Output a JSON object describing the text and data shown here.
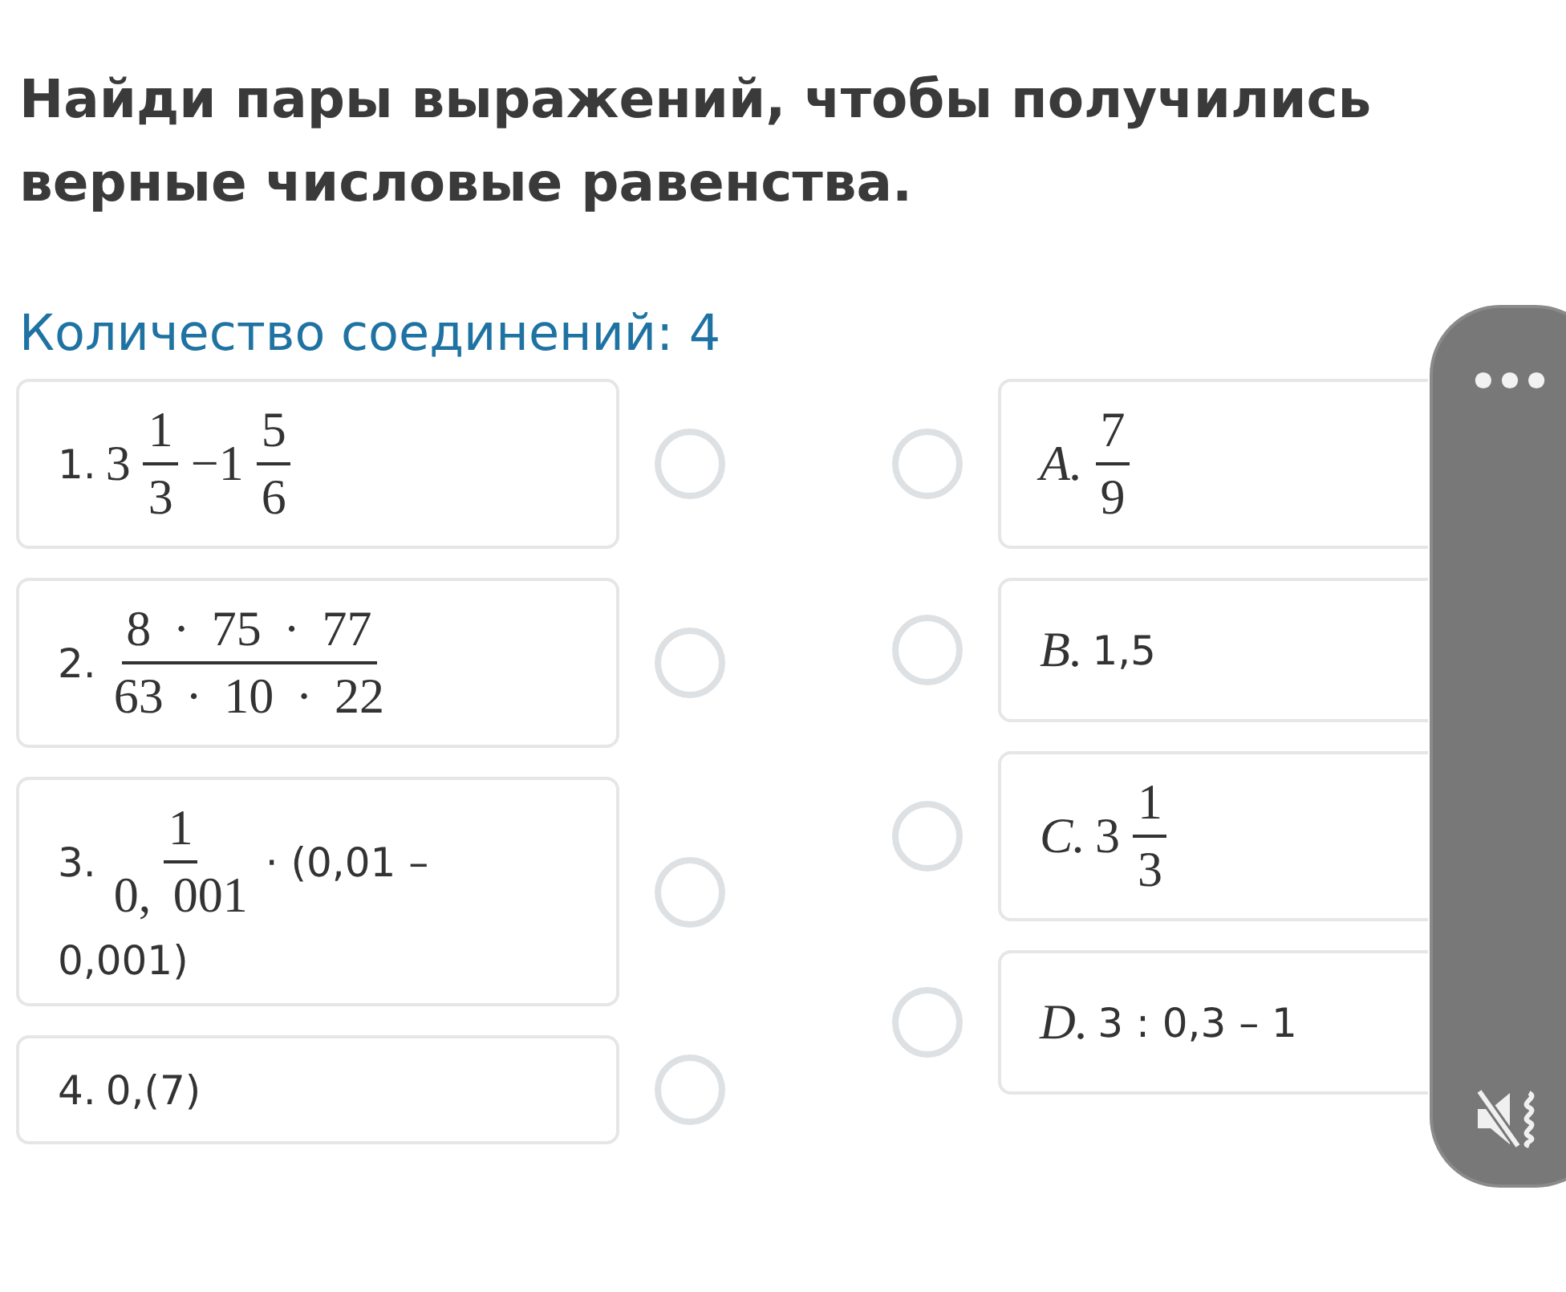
{
  "title": "Найди пары выражений, чтобы получились верные числовые равенства.",
  "connections": "Количество соединений: 4",
  "left_items": [
    {
      "label": "1.",
      "selected": false,
      "parts": [
        {
          "kind": "math",
          "text": "3"
        },
        {
          "kind": "frac",
          "num": "1",
          "den": "3"
        },
        {
          "kind": "math",
          "text": "−1"
        },
        {
          "kind": "frac",
          "num": "5",
          "den": "6"
        }
      ]
    },
    {
      "label": "2.",
      "selected": false,
      "parts": [
        {
          "kind": "frac",
          "num": "8 · 75 · 77",
          "den": "63 · 10 · 22"
        }
      ]
    },
    {
      "label": "3.",
      "selected": false,
      "parts": [
        {
          "kind": "frac",
          "num": "1",
          "den": "0, 001"
        },
        {
          "kind": "text",
          "text": "· (0,01 –"
        },
        {
          "kind": "newline",
          "text": "0,001)"
        }
      ]
    },
    {
      "label": "4.",
      "selected": false,
      "parts": [
        {
          "kind": "text",
          "text": "0,(7)"
        }
      ]
    }
  ],
  "right_items": [
    {
      "label": "A.",
      "selected": false,
      "parts": [
        {
          "kind": "frac",
          "num": "7",
          "den": "9"
        }
      ]
    },
    {
      "label": "B.",
      "selected": false,
      "parts": [
        {
          "kind": "text",
          "text": "1,5"
        }
      ]
    },
    {
      "label": "C.",
      "selected": false,
      "parts": [
        {
          "kind": "math",
          "text": "3"
        },
        {
          "kind": "frac",
          "num": "1",
          "den": "3"
        }
      ]
    },
    {
      "label": "D.",
      "selected": false,
      "parts": [
        {
          "kind": "text",
          "text": "3 : 0,3 – 1"
        }
      ]
    }
  ]
}
